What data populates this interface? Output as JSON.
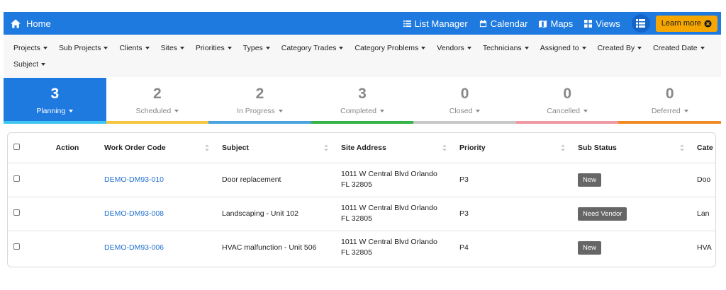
{
  "topnav": {
    "home_label": "Home",
    "items": [
      {
        "label": "List Manager",
        "icon": "list-icon"
      },
      {
        "label": "Calendar",
        "icon": "calendar-icon"
      },
      {
        "label": "Maps",
        "icon": "map-icon"
      },
      {
        "label": "Views",
        "icon": "views-icon"
      }
    ],
    "learn_more": "Learn more"
  },
  "filters": [
    "Projects",
    "Sub Projects",
    "Clients",
    "Sites",
    "Priorities",
    "Types",
    "Category Trades",
    "Category Problems",
    "Vendors",
    "Technicians",
    "Assigned to",
    "Created By",
    "Created Date",
    "Subject"
  ],
  "status_tabs": [
    {
      "count": "3",
      "label": "Planning",
      "color": "#3ec6f0",
      "active": true
    },
    {
      "count": "2",
      "label": "Scheduled",
      "color": "#f5c542"
    },
    {
      "count": "2",
      "label": "In Progress",
      "color": "#4aa3df"
    },
    {
      "count": "3",
      "label": "Completed",
      "color": "#34b34a"
    },
    {
      "count": "0",
      "label": "Closed",
      "color": "#c8c8c8"
    },
    {
      "count": "0",
      "label": "Cancelled",
      "color": "#ef9aa3"
    },
    {
      "count": "0",
      "label": "Deferred",
      "color": "#f08a24"
    }
  ],
  "table": {
    "headers": {
      "action": "Action",
      "code": "Work Order Code",
      "subject": "Subject",
      "address": "Site Address",
      "priority": "Priority",
      "sub_status": "Sub Status",
      "category": "Cate"
    },
    "rows": [
      {
        "code": "DEMO-DM93-010",
        "subject": "Door replacement",
        "address_line1": "1011 W Central Blvd Orlando",
        "address_line2": "FL 32805",
        "priority": "P3",
        "sub_status": "New",
        "category": "Doo"
      },
      {
        "code": "DEMO-DM93-008",
        "subject": "Landscaping - Unit 102",
        "address_line1": "1011 W Central Blvd Orlando",
        "address_line2": "FL 32805",
        "priority": "P3",
        "sub_status": "Need Vendor",
        "category": "Lan"
      },
      {
        "code": "DEMO-DM93-006",
        "subject": "HVAC malfunction - Unit 506",
        "address_line1": "1011 W Central Blvd Orlando",
        "address_line2": "FL 32805",
        "priority": "P4",
        "sub_status": "New",
        "category": "HVA"
      }
    ]
  }
}
